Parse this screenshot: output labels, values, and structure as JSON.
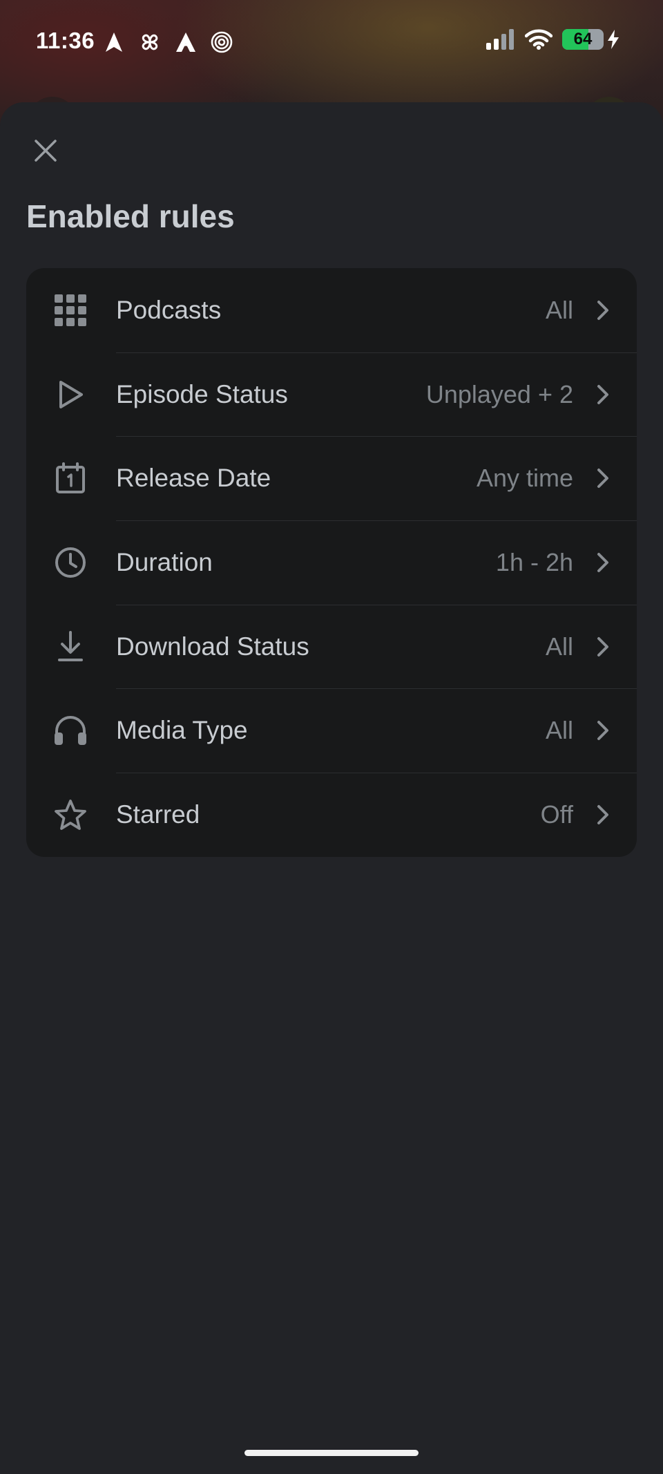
{
  "status_bar": {
    "time": "11:36",
    "battery_level": "64",
    "battery_percent": 64,
    "left_icons": [
      "navigation-arrow-icon",
      "pinwheel-icon",
      "arc-triangle-icon",
      "spiral-icon"
    ],
    "right_icons": [
      "cellular-signal-icon",
      "wifi-icon",
      "battery-icon",
      "charging-bolt-icon"
    ]
  },
  "sheet": {
    "title": "Enabled rules",
    "close_icon": "close-icon"
  },
  "rules": [
    {
      "label": "Podcasts",
      "value": "All",
      "icon": "grid-icon"
    },
    {
      "label": "Episode Status",
      "value": "Unplayed + 2",
      "icon": "play-icon"
    },
    {
      "label": "Release Date",
      "value": "Any time",
      "icon": "calendar-icon"
    },
    {
      "label": "Duration",
      "value": "1h - 2h",
      "icon": "clock-icon"
    },
    {
      "label": "Download Status",
      "value": "All",
      "icon": "download-icon"
    },
    {
      "label": "Media Type",
      "value": "All",
      "icon": "headphones-icon"
    },
    {
      "label": "Starred",
      "value": "Off",
      "icon": "star-icon"
    }
  ],
  "colors": {
    "sheet_background": "#222327",
    "card_background": "#18191a",
    "label_text": "#c8ccd1",
    "value_text": "#7f8489",
    "icon": "#8a8e93",
    "battery_fill": "#22c45a"
  }
}
